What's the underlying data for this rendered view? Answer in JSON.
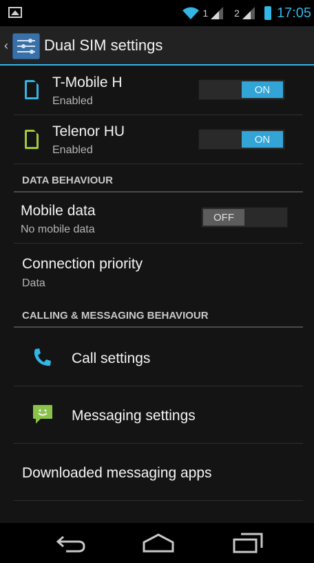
{
  "status_bar": {
    "sim1_label": "1",
    "sim2_label": "2",
    "time": "17:05",
    "accent_color": "#33b5e5"
  },
  "action_bar": {
    "title": "Dual SIM settings",
    "icon": "settings-sliders-icon"
  },
  "sims": [
    {
      "name": "T-Mobile H",
      "status": "Enabled",
      "toggle": "ON",
      "color": "#33b5e5"
    },
    {
      "name": "Telenor HU",
      "status": "Enabled",
      "toggle": "ON",
      "color": "#a4c93a"
    }
  ],
  "data_behaviour": {
    "header": "DATA BEHAVIOUR",
    "mobile_data": {
      "title": "Mobile data",
      "summary": "No mobile data",
      "toggle": "OFF"
    },
    "connection_priority": {
      "title": "Connection priority",
      "summary": "Data"
    }
  },
  "calling": {
    "header": "CALLING & MESSAGING BEHAVIOUR",
    "call_settings": "Call settings",
    "messaging_settings": "Messaging settings",
    "downloaded_apps": "Downloaded messaging apps"
  },
  "nav_bar": {
    "back": "back-icon",
    "home": "home-icon",
    "recents": "recent-apps-icon"
  }
}
